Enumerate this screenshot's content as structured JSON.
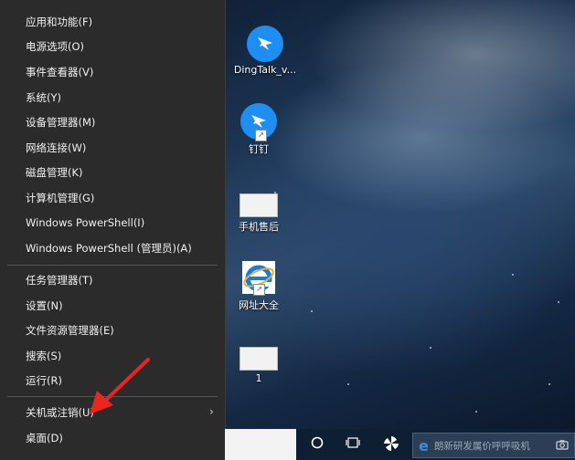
{
  "context_menu": {
    "items": [
      {
        "label": "应用和功能(F)"
      },
      {
        "label": "电源选项(O)"
      },
      {
        "label": "事件查看器(V)"
      },
      {
        "label": "系统(Y)"
      },
      {
        "label": "设备管理器(M)"
      },
      {
        "label": "网络连接(W)"
      },
      {
        "label": "磁盘管理(K)"
      },
      {
        "label": "计算机管理(G)"
      },
      {
        "label": "Windows PowerShell(I)"
      },
      {
        "label": "Windows PowerShell (管理员)(A)"
      },
      {
        "label": "任务管理器(T)"
      },
      {
        "label": "设置(N)"
      },
      {
        "label": "文件资源管理器(E)"
      },
      {
        "label": "搜索(S)"
      },
      {
        "label": "运行(R)"
      },
      {
        "label": "关机或注销(U)"
      },
      {
        "label": "桌面(D)"
      }
    ]
  },
  "desktop_icons": [
    {
      "label": "DingTalk_v...",
      "icon": "dingtalk-icon"
    },
    {
      "label": "钉钉",
      "icon": "dingtalk-icon"
    },
    {
      "label": "手机售后",
      "icon": "document-thumbnail-icon"
    },
    {
      "label": "网址大全",
      "icon": "ie-icon"
    },
    {
      "label": "1",
      "icon": "file-thumbnail-icon"
    }
  ],
  "taskbar": {
    "search_text": "朗新研发属价呼呼吸机"
  },
  "colors": {
    "menu_bg": "#2b2b2b",
    "accent_arrow": "#e8261f",
    "dingtalk_blue": "#1e8ef2"
  }
}
